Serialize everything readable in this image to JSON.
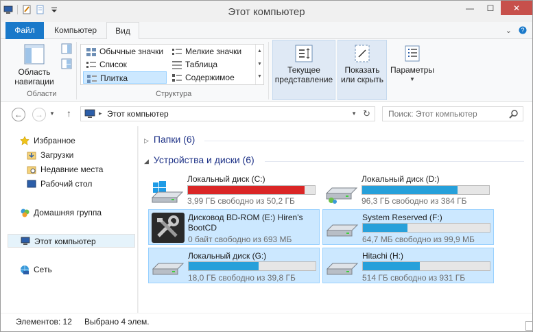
{
  "window": {
    "title": "Этот компьютер",
    "minimize": "—",
    "maximize": "☐",
    "close": "✕"
  },
  "ribbon_tabs": {
    "file": "Файл",
    "computer": "Компьютер",
    "view": "Вид"
  },
  "ribbon": {
    "nav_pane_label": "Область навигации",
    "areas_group": "Области",
    "layout_group": "Структура",
    "layout_items": {
      "large_icons": "Обычные значки",
      "small_icons": "Мелкие значки",
      "list": "Список",
      "table": "Таблица",
      "tiles": "Плитка",
      "content": "Содержимое"
    },
    "current_view": "Текущее представление",
    "show_hide": "Показать или скрыть",
    "options": "Параметры"
  },
  "address": {
    "path": "Этот компьютер",
    "search_placeholder": "Поиск: Этот компьютер"
  },
  "sidebar": {
    "favorites": "Избранное",
    "downloads": "Загрузки",
    "recent": "Недавние места",
    "desktop": "Рабочий стол",
    "homegroup": "Домашняя группа",
    "this_pc": "Этот компьютер",
    "network": "Сеть"
  },
  "sections": {
    "folders": "Папки (6)",
    "devices": "Устройства и диски (6)"
  },
  "drives": [
    {
      "name": "Локальный диск (C:)",
      "free_text": "3,99 ГБ свободно из 50,2 ГБ",
      "used_fraction": 0.92,
      "warn": true
    },
    {
      "name": "Локальный диск (D:)",
      "free_text": "96,3 ГБ свободно из 384 ГБ",
      "used_fraction": 0.75,
      "warn": false
    },
    {
      "name": "Дисковод BD-ROM (E:) Hiren's BootCD",
      "free_text": "0 байт свободно из 693 МБ",
      "selected": true
    },
    {
      "name": "System Reserved (F:)",
      "free_text": "64,7 МБ свободно из 99,9 МБ",
      "used_fraction": 0.35,
      "warn": false,
      "selected": true
    },
    {
      "name": "Локальный диск (G:)",
      "free_text": "18,0 ГБ свободно из 39,8 ГБ",
      "used_fraction": 0.55,
      "warn": false,
      "selected": true
    },
    {
      "name": "Hitachi (H:)",
      "free_text": "514 ГБ свободно из 931 ГБ",
      "used_fraction": 0.45,
      "warn": false,
      "selected": true
    }
  ],
  "status": {
    "items": "Элементов: 12",
    "selected": "Выбрано 4 элем."
  },
  "colors": {
    "accent": "#1979ca",
    "bar": "#26a0da",
    "bar_warn": "#da2626",
    "selection": "#cce8ff"
  }
}
